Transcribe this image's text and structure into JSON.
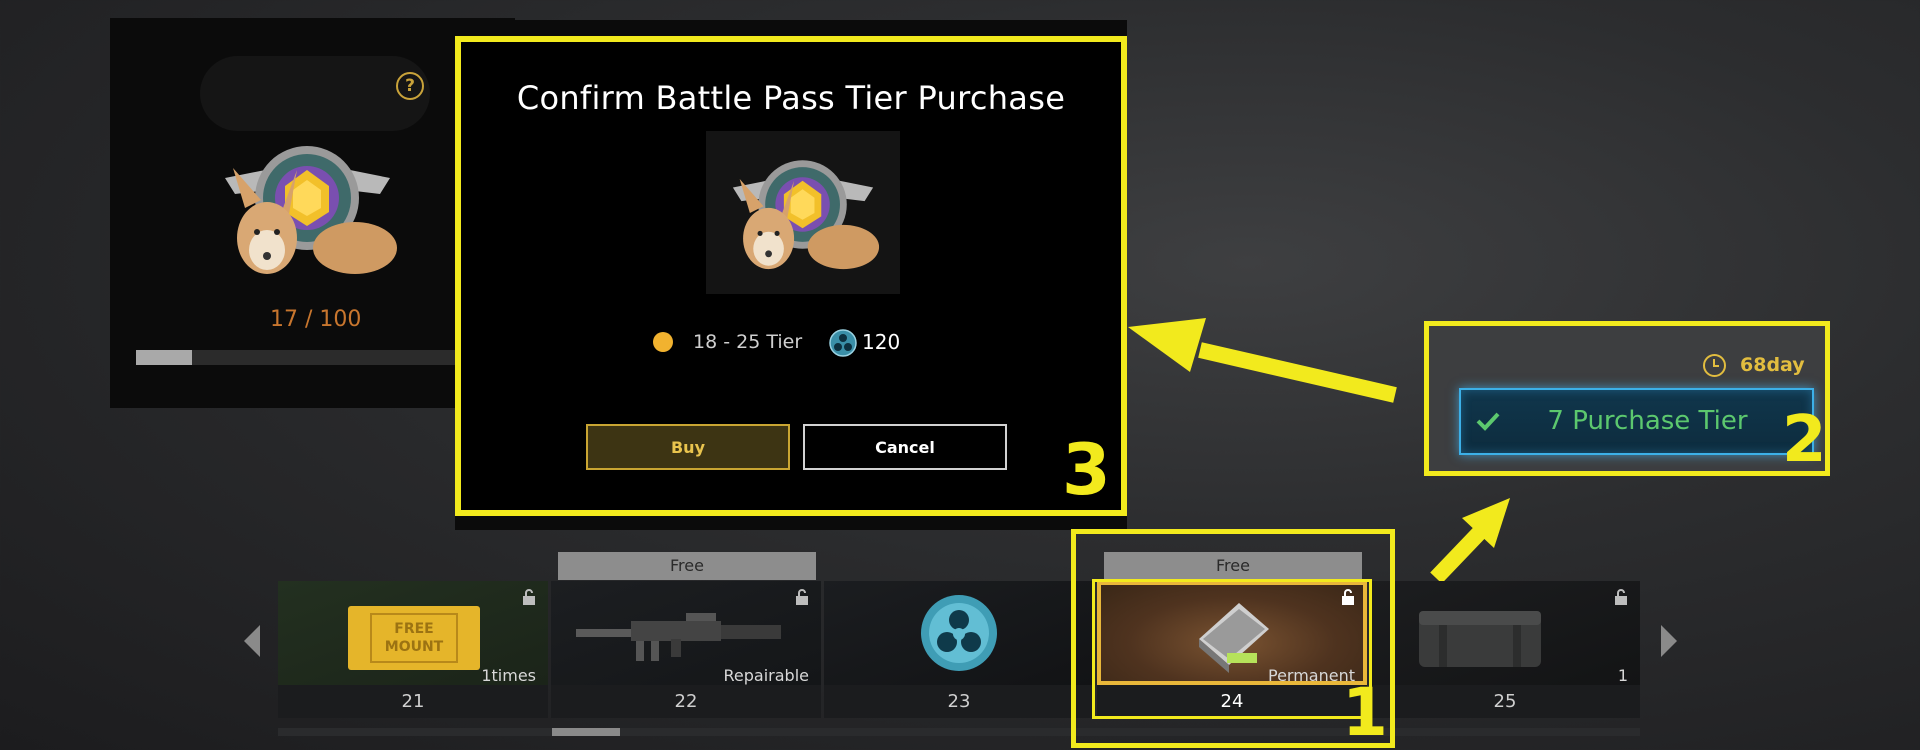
{
  "left_panel": {
    "progress_text": "17 / 100",
    "progress_fraction": 0.17
  },
  "dialog": {
    "title": "Confirm Battle Pass Tier Purchase",
    "tier_range": "18 - 25 Tier",
    "cost": "120",
    "buy_label": "Buy",
    "cancel_label": "Cancel"
  },
  "purchase_box": {
    "days_left": "68day",
    "button_label": "7 Purchase Tier"
  },
  "annotations": {
    "label_1": "1",
    "label_2": "2",
    "label_3": "3"
  },
  "track": {
    "free_label": "Free",
    "cells": [
      {
        "tier": "21",
        "qty": "1times",
        "item": "FREE MOUNT"
      },
      {
        "tier": "22",
        "qty": "Repairable",
        "free": true
      },
      {
        "tier": "23",
        "qty": ""
      },
      {
        "tier": "24",
        "qty": "Permanent",
        "free": true
      },
      {
        "tier": "25",
        "qty": "1"
      }
    ]
  },
  "colors": {
    "highlight": "#f2ea1d",
    "accent_gold": "#e9c44e",
    "purchase_green": "#5cc86e",
    "purchase_blue": "#3cb0e8"
  }
}
